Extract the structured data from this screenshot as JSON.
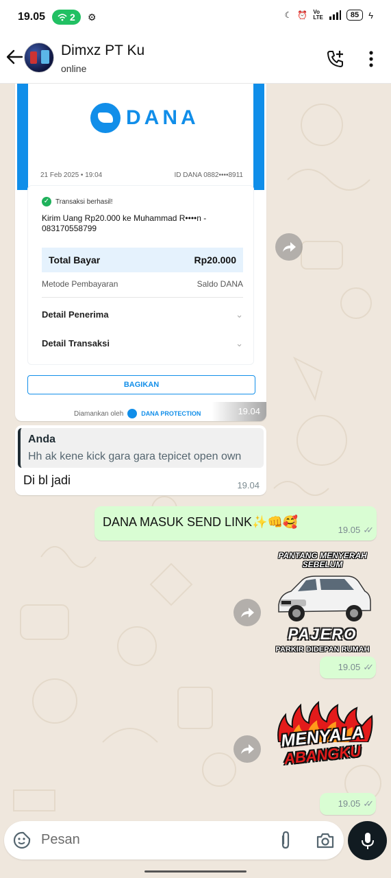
{
  "status_bar": {
    "time": "19.05",
    "notif_count": "2",
    "battery": "85"
  },
  "header": {
    "contact_name": "Dimxz PT Ku",
    "status": "online"
  },
  "receipt": {
    "brand": "DANA",
    "date": "21 Feb 2025 • 19:04",
    "id": "ID DANA 0882••••8911",
    "success": "Transaksi berhasil!",
    "description": "Kirim Uang Rp20.000 ke Muhammad R••••n - 083170558799",
    "total_label": "Total Bayar",
    "total_value": "Rp20.000",
    "method_label": "Metode Pembayaran",
    "method_value": "Saldo DANA",
    "detail_penerima": "Detail Penerima",
    "detail_transaksi": "Detail Transaksi",
    "share_button": "BAGIKAN",
    "secured_by": "Diamankan oleh",
    "protection": "DANA PROTECTION",
    "time": "19.04"
  },
  "reply_message": {
    "quoted_author": "Anda",
    "quoted_text": "Hh ak kene kick gara gara tepicet open own",
    "text": "Di bl jadi",
    "time": "19.04"
  },
  "out_message": {
    "text": "DANA MASUK SEND LINK✨👊🥰",
    "time": "19.05"
  },
  "sticker1": {
    "top_text": "PANTANG MENYERAH SEBELUM",
    "brand_text": "PAJERO",
    "bottom_text": "PARKIR DIDEPAN RUMAH",
    "time": "19.05"
  },
  "sticker2": {
    "line1": "MENYALA",
    "line2": "ABANGKU",
    "time": "19.05"
  },
  "composer": {
    "placeholder": "Pesan"
  },
  "colors": {
    "accent_green": "#21c063",
    "dana_blue": "#118ee9",
    "out_bubble": "#d9fdd3",
    "chat_bg": "#efe7dd"
  }
}
